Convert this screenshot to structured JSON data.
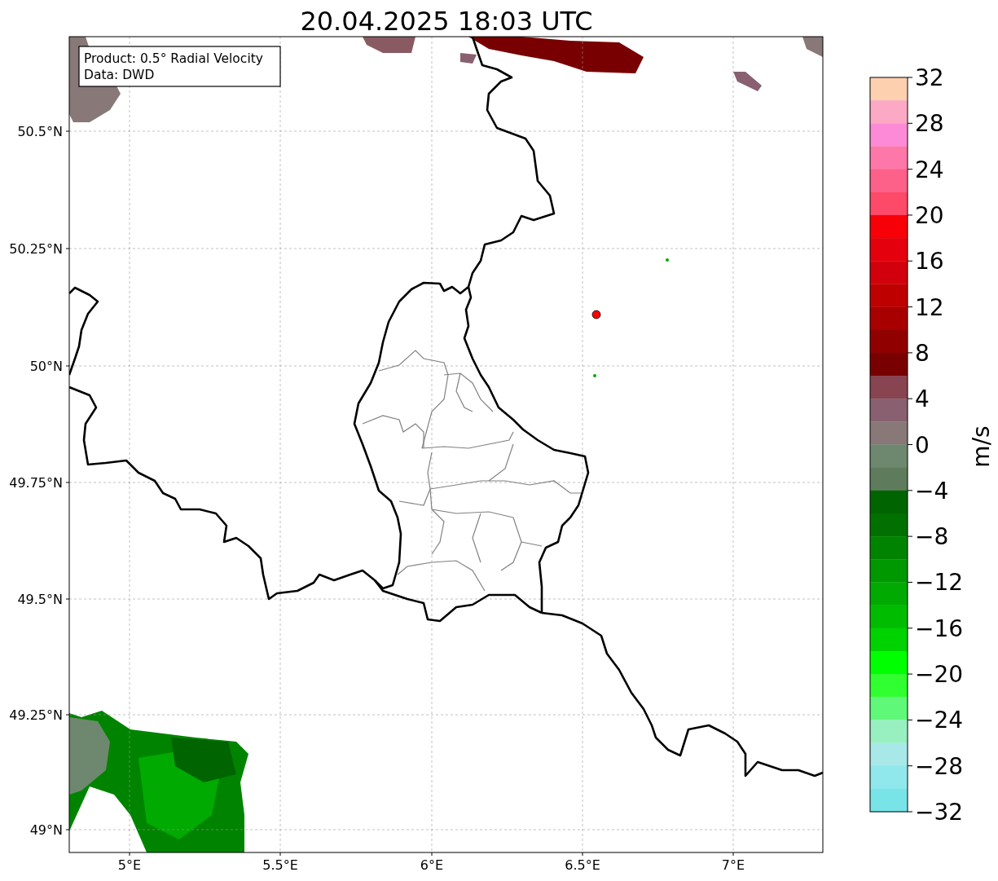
{
  "title": "20.04.2025 18:03 UTC",
  "map": {
    "info_lines": [
      "Product: 0.5° Radial Velocity",
      "Data: DWD"
    ],
    "y_tick_labels": [
      "50.5°N",
      "50.25°N",
      "50°N",
      "49.75°N",
      "49.5°N",
      "49.25°N",
      "49°N"
    ],
    "x_tick_labels": [
      "5°E",
      "5.5°E",
      "6°E",
      "6.5°E",
      "7°E"
    ]
  },
  "colorbar": {
    "label": "m/s",
    "tick_labels": [
      "32",
      "28",
      "24",
      "20",
      "16",
      "12",
      "8",
      "4",
      "0",
      "−4",
      "−8",
      "−12",
      "−16",
      "−20",
      "−24",
      "−28",
      "−32"
    ],
    "bands": [
      {
        "color": "#fdd0b0"
      },
      {
        "color": "#fca9c6"
      },
      {
        "color": "#fd8ad6"
      },
      {
        "color": "#fd78a8"
      },
      {
        "color": "#fd6088"
      },
      {
        "color": "#fd4a68"
      },
      {
        "color": "#f80008"
      },
      {
        "color": "#e4000c"
      },
      {
        "color": "#d2000c"
      },
      {
        "color": "#be0000"
      },
      {
        "color": "#a80000"
      },
      {
        "color": "#900000"
      },
      {
        "color": "#780000"
      },
      {
        "color": "#884450"
      },
      {
        "color": "#886070"
      },
      {
        "color": "#887878"
      },
      {
        "color": "#6e8870"
      },
      {
        "color": "#5e7c5c"
      },
      {
        "color": "#006400"
      },
      {
        "color": "#007000"
      },
      {
        "color": "#008400"
      },
      {
        "color": "#009800"
      },
      {
        "color": "#00aa00"
      },
      {
        "color": "#00bc00"
      },
      {
        "color": "#00d200"
      },
      {
        "color": "#00ff00"
      },
      {
        "color": "#30ff30"
      },
      {
        "color": "#60f878"
      },
      {
        "color": "#98f0c0"
      },
      {
        "color": "#a8e8e8"
      },
      {
        "color": "#90e8ec"
      },
      {
        "color": "#78e4e8"
      }
    ]
  }
}
